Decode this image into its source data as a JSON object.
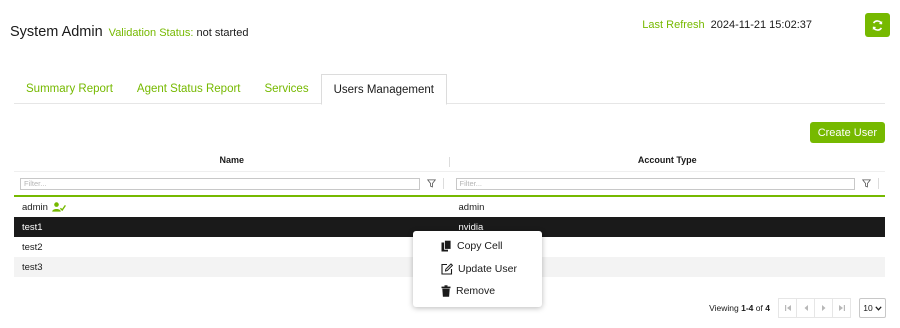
{
  "header": {
    "title": "System Admin",
    "validation_label": "Validation Status:",
    "validation_value": "not started",
    "refresh_label": "Last Refresh",
    "refresh_value": "2024-11-21 15:02:37"
  },
  "tabs": [
    {
      "label": "Summary Report"
    },
    {
      "label": "Agent Status Report"
    },
    {
      "label": "Services"
    },
    {
      "label": "Users Management",
      "active": true
    }
  ],
  "toolbar": {
    "create_user_label": "Create User"
  },
  "table": {
    "columns": [
      "Name",
      "Account Type"
    ],
    "filter_placeholder": "Filter...",
    "rows": [
      {
        "name": "admin",
        "account_type": "admin"
      },
      {
        "name": "test1",
        "account_type": "nvidia"
      },
      {
        "name": "test2",
        "account_type": ""
      },
      {
        "name": "test3",
        "account_type": ""
      }
    ]
  },
  "context_menu": {
    "items": [
      {
        "label": "Copy Cell",
        "icon": "copy-icon"
      },
      {
        "label": "Update User",
        "icon": "edit-icon"
      },
      {
        "label": "Remove",
        "icon": "trash-icon"
      }
    ]
  },
  "pagination": {
    "prefix": "Viewing",
    "range": "1-4",
    "of_label": "of",
    "total": "4",
    "page_size": "10"
  },
  "colors": {
    "accent": "#76b900",
    "selected_row": "#1a1a1a"
  }
}
